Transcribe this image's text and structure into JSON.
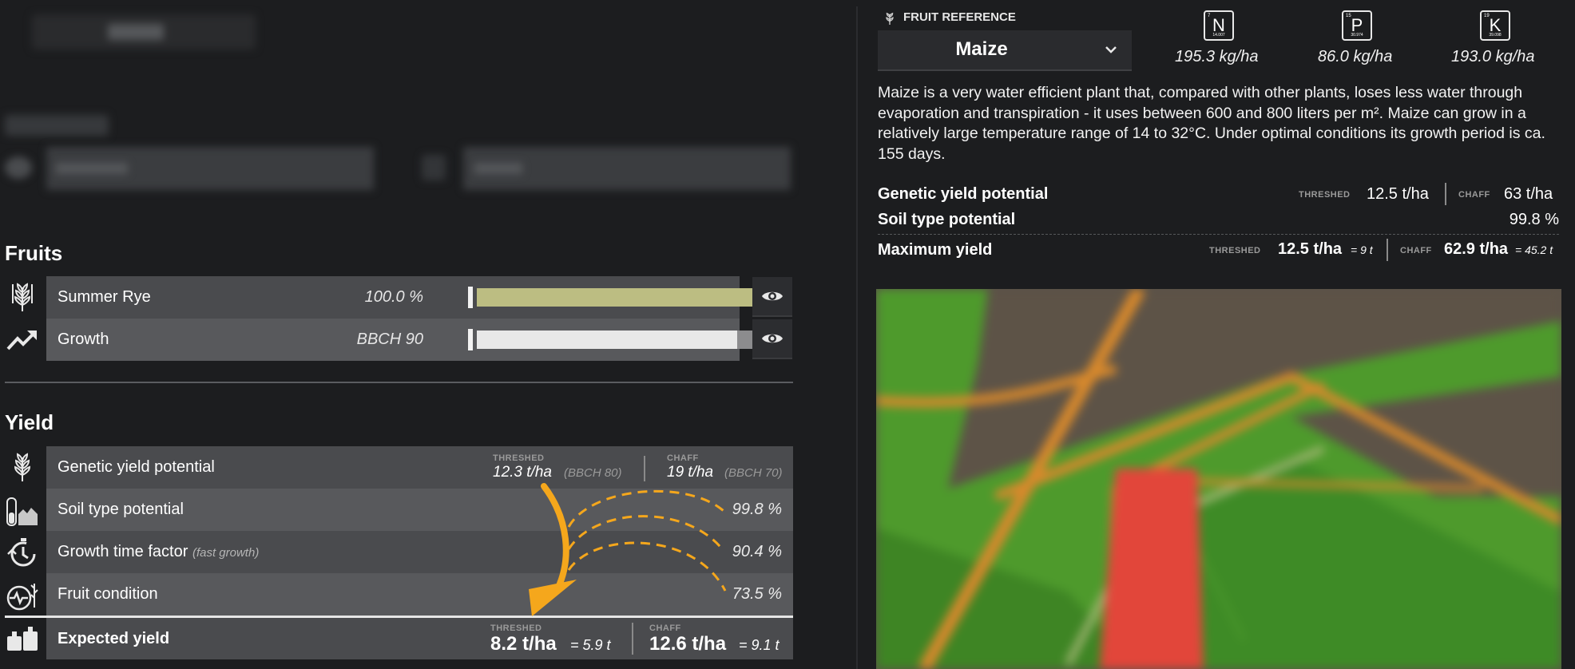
{
  "fruits": {
    "title": "Fruits",
    "rows": [
      {
        "label": "Summer Rye",
        "value": "100.0 %",
        "fill": 1.0,
        "color": "#bcbd82"
      },
      {
        "label": "Growth",
        "value": "BBCH 90",
        "fill": 0.9,
        "color": "#e8e8e8"
      }
    ]
  },
  "yield": {
    "title": "Yield",
    "genetic": {
      "label": "Genetic yield potential",
      "threshed_label": "THRESHED",
      "threshed": "12.3 t/ha",
      "threshed_note": "(BBCH 80)",
      "chaff_label": "CHAFF",
      "chaff": "19 t/ha",
      "chaff_note": "(BBCH 70)"
    },
    "soil": {
      "label": "Soil type potential",
      "value": "99.8 %"
    },
    "growth_time": {
      "label": "Growth time factor",
      "note": "(fast growth)",
      "value": "90.4 %"
    },
    "condition": {
      "label": "Fruit condition",
      "value": "73.5 %"
    },
    "expected": {
      "label": "Expected yield",
      "threshed_label": "THRESHED",
      "threshed": "8.2 t/ha",
      "threshed_total": "= 5.9 t",
      "chaff_label": "CHAFF",
      "chaff": "12.6 t/ha",
      "chaff_total": "= 9.1 t"
    }
  },
  "reference": {
    "header": "FRUIT REFERENCE",
    "selected": "Maize",
    "nutrients": [
      {
        "symbol": "N",
        "number": "7",
        "mass": "14.007",
        "amount": "195.3 kg/ha"
      },
      {
        "symbol": "P",
        "number": "15",
        "mass": "30.974",
        "amount": "86.0 kg/ha"
      },
      {
        "symbol": "K",
        "number": "19",
        "mass": "39.098",
        "amount": "193.0 kg/ha"
      }
    ],
    "description": "Maize is a very water efficient plant that, compared with other plants, loses less water through evaporation and transpiration - it uses between 600 and 800 liters per m². Maize can grow in a relatively large temperature range of 14 to 32°C. Under optimal conditions its growth period is ca. 155 days.",
    "genetic": {
      "label": "Genetic yield potential",
      "threshed_label": "THRESHED",
      "threshed": "12.5 t/ha",
      "chaff_label": "CHAFF",
      "chaff": "63 t/ha"
    },
    "soil": {
      "label": "Soil type potential",
      "value": "99.8 %"
    },
    "maximum": {
      "label": "Maximum yield",
      "threshed_label": "THRESHED",
      "threshed": "12.5 t/ha",
      "threshed_total": "= 9 t",
      "chaff_label": "CHAFF",
      "chaff": "62.9 t/ha",
      "chaff_total": "= 45.2 t"
    }
  },
  "colors": {
    "accent": "#f5a71c",
    "fruit_bar": "#bcbd82",
    "map_red": "#e2463a",
    "map_green": "#4e9a2c"
  },
  "icons": [
    "wheat-icon",
    "growth-arrow-icon",
    "eye-icon",
    "soil-icon",
    "stopwatch-icon",
    "condition-icon",
    "weights-icon",
    "chevron-down-icon"
  ]
}
